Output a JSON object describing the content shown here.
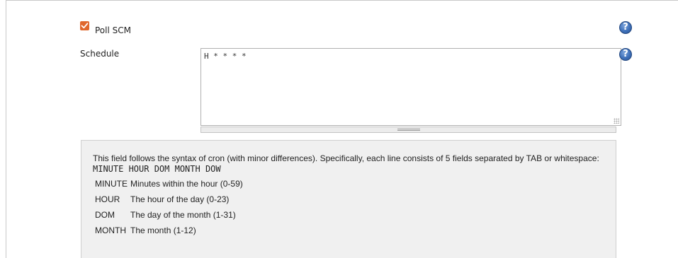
{
  "poll_scm": {
    "label": "Poll SCM",
    "checked": true,
    "checkbox_color": "#e0672d",
    "help_icon": "question-icon"
  },
  "schedule": {
    "label": "Schedule",
    "value": "H * * * *",
    "help_icon": "question-icon"
  },
  "help": {
    "intro": "This field follows the syntax of cron (with minor differences). Specifically, each line consists of 5 fields separated by TAB or whitespace:",
    "syntax": "MINUTE HOUR DOM MONTH DOW",
    "fields": [
      {
        "name": "MINUTE",
        "description": "Minutes within the hour (0-59)"
      },
      {
        "name": "HOUR",
        "description": "The hour of the day (0-23)"
      },
      {
        "name": "DOM",
        "description": "The day of the month (1-31)"
      },
      {
        "name": "MONTH",
        "description": "The month (1-12)"
      }
    ]
  }
}
